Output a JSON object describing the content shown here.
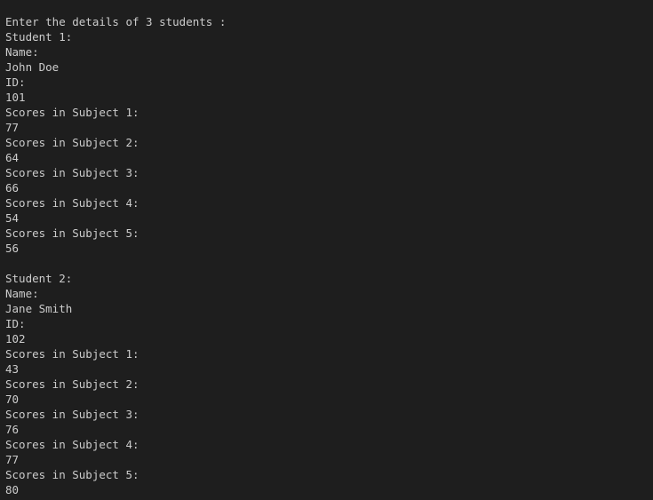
{
  "terminal": {
    "prompt": "Enter the details of 3 students :",
    "students": [
      {
        "heading": "Student 1:",
        "name_label": "Name:",
        "name": "John Doe",
        "id_label": "ID:",
        "id": "101",
        "subjects": [
          {
            "label": "Scores in Subject 1:",
            "score": "77"
          },
          {
            "label": "Scores in Subject 2:",
            "score": "64"
          },
          {
            "label": "Scores in Subject 3:",
            "score": "66"
          },
          {
            "label": "Scores in Subject 4:",
            "score": "54"
          },
          {
            "label": "Scores in Subject 5:",
            "score": "56"
          }
        ]
      },
      {
        "heading": "Student 2:",
        "name_label": "Name:",
        "name": "Jane Smith",
        "id_label": "ID:",
        "id": "102",
        "subjects": [
          {
            "label": "Scores in Subject 1:",
            "score": "43"
          },
          {
            "label": "Scores in Subject 2:",
            "score": "70"
          },
          {
            "label": "Scores in Subject 3:",
            "score": "76"
          },
          {
            "label": "Scores in Subject 4:",
            "score": "77"
          },
          {
            "label": "Scores in Subject 5:",
            "score": "80"
          }
        ]
      }
    ]
  },
  "colors": {
    "background": "#1e1e1e",
    "text": "#cccccc"
  }
}
